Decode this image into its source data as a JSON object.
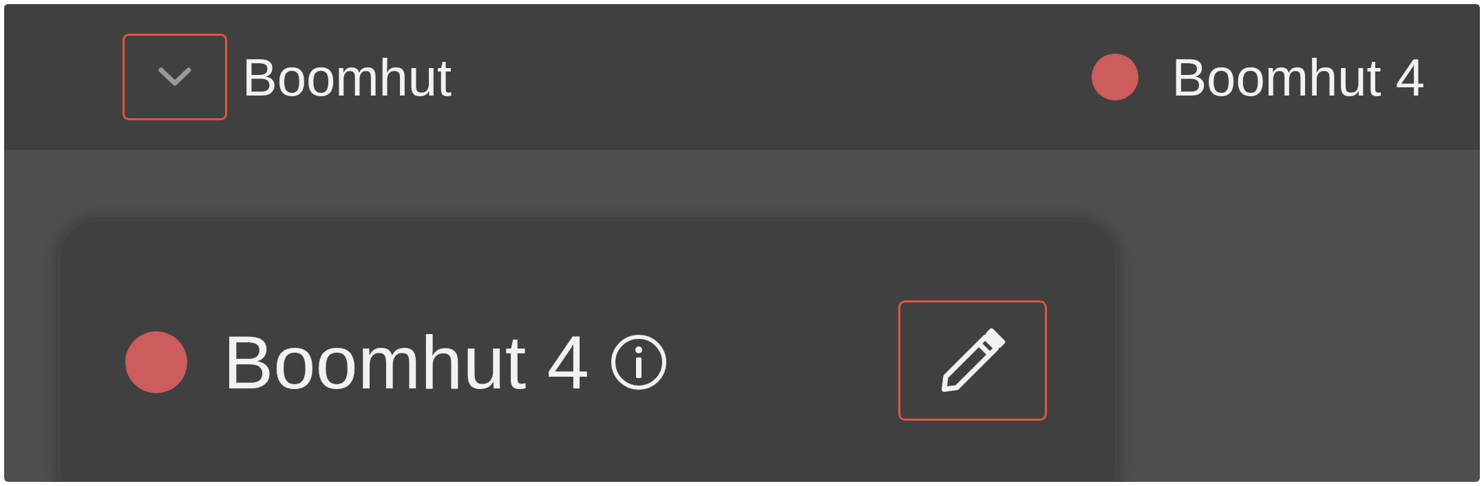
{
  "top_bar": {
    "title": "Boomhut",
    "current": {
      "label": "Boomhut 4",
      "color": "#cd5c5c"
    }
  },
  "card": {
    "title": "Boomhut 4",
    "color": "#cd5c5c"
  }
}
